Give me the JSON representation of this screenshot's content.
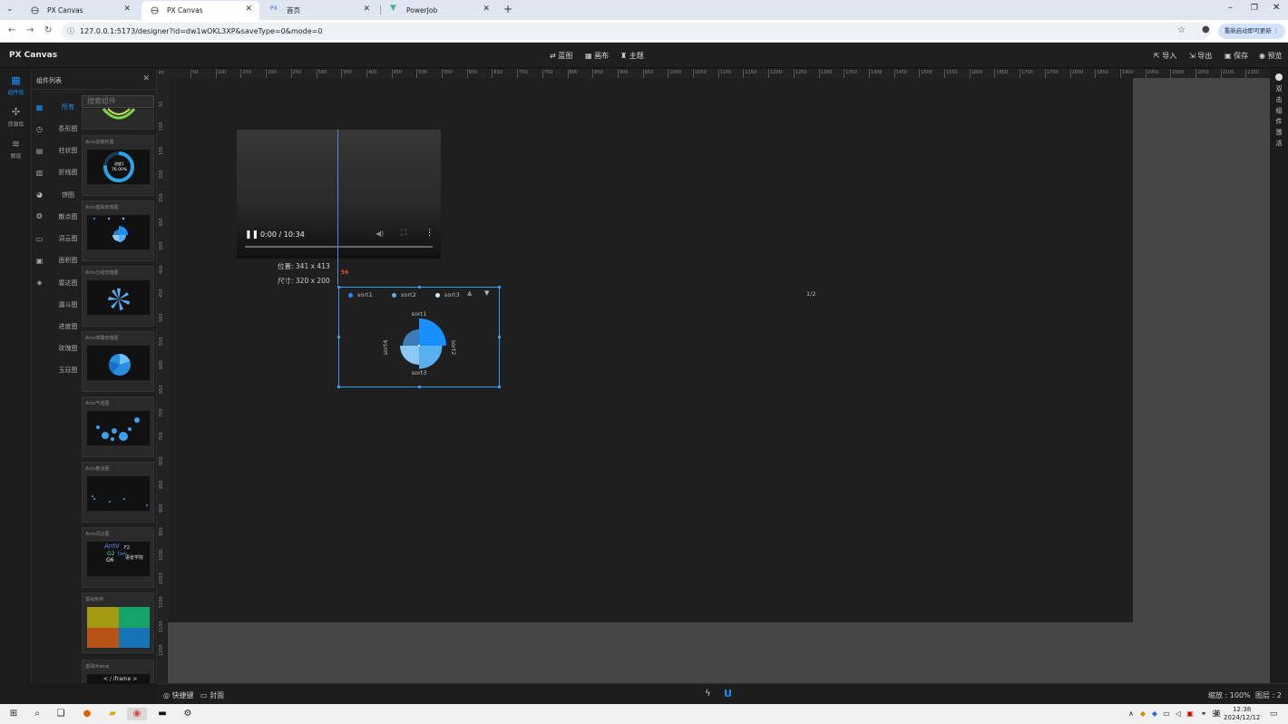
{
  "browser": {
    "tabs": [
      {
        "label": "PX Canvas",
        "active": false
      },
      {
        "label": "PX Canvas",
        "active": true
      },
      {
        "label": "首页",
        "active": false
      },
      {
        "label": "PowerJob",
        "active": false
      }
    ],
    "url": "127.0.0.1:5173/designer?id=dw1wOKL3XP&saveType=0&mode=0",
    "relaunch_label": "重新启动即可更新"
  },
  "app": {
    "title": "PX Canvas",
    "center_menu": [
      "蓝图",
      "画布",
      "主题"
    ],
    "right_menu": [
      "导入",
      "导出",
      "保存",
      "预览"
    ]
  },
  "rail": [
    {
      "label": "组件库",
      "icon": "grid-icon",
      "active": true
    },
    {
      "label": "资源库",
      "icon": "network-icon",
      "active": false
    },
    {
      "label": "图层",
      "icon": "layers-icon",
      "active": false
    }
  ],
  "panel": {
    "title": "组件列表",
    "search_placeholder": "搜索组件",
    "categories": [
      "所有",
      "条形图",
      "柱状图",
      "折线图",
      "饼图",
      "散点图",
      "词云图",
      "面积图",
      "雷达图",
      "漏斗图",
      "进度图",
      "玫瑰图",
      "玉珏图"
    ],
    "cards": [
      "",
      "Antv进度环图",
      "Antv基础玫瑰图",
      "Antv分组玫瑰图",
      "Antv堆叠玫瑰图",
      "Antv气泡图",
      "Antv散点图",
      "Antv词云图",
      "基础色块",
      "基础iframe"
    ],
    "progress_thumb_label": "进度1",
    "progress_thumb_value": "76.00%",
    "wordcloud_words": [
      "AntV",
      "G2",
      "G6",
      "F2",
      "Dev",
      "语雀学院"
    ],
    "iframe_thumb_text": "< / iframe >",
    "colorblock_colors": [
      "#a59a12",
      "#16a36a",
      "#b85216",
      "#1673b5"
    ]
  },
  "ruler": {
    "unit": "px",
    "h_labels": [
      "50",
      "100",
      "150",
      "200",
      "250",
      "300",
      "350",
      "400",
      "450",
      "500",
      "550",
      "600",
      "650",
      "700",
      "750",
      "800",
      "850",
      "900",
      "950",
      "1000",
      "1050",
      "1100",
      "1150",
      "1200",
      "1250",
      "1300",
      "1350",
      "1400",
      "1450",
      "1500",
      "1550",
      "1600",
      "1650",
      "1700",
      "1750",
      "1800",
      "1850",
      "1900",
      "1950",
      "2000",
      "2050",
      "2100",
      "2150"
    ],
    "v_labels": [
      "50",
      "100",
      "150",
      "200",
      "250",
      "300",
      "350",
      "400",
      "450",
      "500",
      "550",
      "600",
      "650",
      "700",
      "750",
      "800",
      "850",
      "900",
      "950",
      "1000",
      "1050",
      "1100",
      "1150",
      "1200"
    ]
  },
  "canvas": {
    "video": {
      "time": "0:00 / 10:34",
      "progress": 0
    },
    "position_label": "位置: 341 x 413",
    "size_label": "尺寸: 320 x 200",
    "guide_value": "56",
    "pie": {
      "legend": [
        "sort1",
        "sort2",
        "sort3"
      ],
      "pager": "1/2",
      "slice_labels": [
        "sort1",
        "sort2",
        "sort3",
        "sort4"
      ]
    }
  },
  "chart_data": {
    "type": "pie",
    "categories": [
      "sort1",
      "sort2",
      "sort3",
      "sort4"
    ],
    "values": [
      1,
      1,
      1,
      1
    ],
    "radii": [
      1.0,
      0.85,
      0.7,
      0.6
    ],
    "legend": [
      "sort1",
      "sort2",
      "sort3"
    ],
    "colors": [
      "#1890ff",
      "#5aafef",
      "#8cc8f5",
      "#3c7bb6"
    ]
  },
  "right_tips": [
    "双",
    "击",
    "组",
    "件",
    "激",
    "活"
  ],
  "bottom": {
    "shortcut_label": "快捷键",
    "cover_label": "封面",
    "zoom_label": "缩放 : 100%",
    "layers_label": "图层 : 2"
  },
  "taskbar": {
    "time": "12:38",
    "date": "2024/12/12",
    "ime": "英"
  }
}
